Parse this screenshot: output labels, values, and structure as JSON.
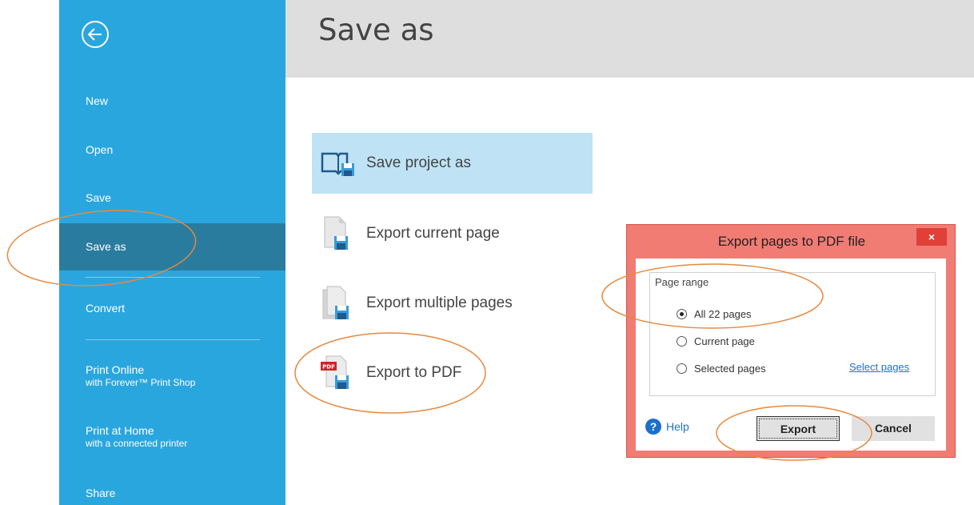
{
  "sidebar": {
    "items": [
      {
        "label": "New"
      },
      {
        "label": "Open"
      },
      {
        "label": "Save"
      },
      {
        "label": "Save as"
      },
      {
        "label": "Convert"
      },
      {
        "label": "Print Online",
        "sub": "with Forever™ Print Shop"
      },
      {
        "label": "Print at Home",
        "sub": "with a connected printer"
      },
      {
        "label": "Share"
      }
    ],
    "active_index": 3,
    "background": "#2aa6de",
    "active_background": "#2a7c9f"
  },
  "header": {
    "title": "Save as"
  },
  "options": [
    {
      "label": "Save project as",
      "icon": "open-book-floppy-icon",
      "selected": true
    },
    {
      "label": "Export current page",
      "icon": "page-floppy-icon",
      "selected": false
    },
    {
      "label": "Export multiple pages",
      "icon": "pages-floppy-icon",
      "selected": false
    },
    {
      "label": "Export to PDF",
      "icon": "pdf-floppy-icon",
      "badge": "PDF",
      "selected": false
    }
  ],
  "dialog": {
    "title": "Export pages to PDF file",
    "close_label": "×",
    "group_label": "Page range",
    "radios": [
      {
        "label": "All 22 pages",
        "checked": true
      },
      {
        "label": "Current page",
        "checked": false
      },
      {
        "label": "Selected pages",
        "checked": false
      }
    ],
    "select_pages_link": "Select pages",
    "help_label": "Help",
    "help_glyph": "?",
    "export_button": "Export",
    "cancel_button": "Cancel",
    "frame_color": "#f07c74"
  },
  "annotation_color": "#e8883e"
}
